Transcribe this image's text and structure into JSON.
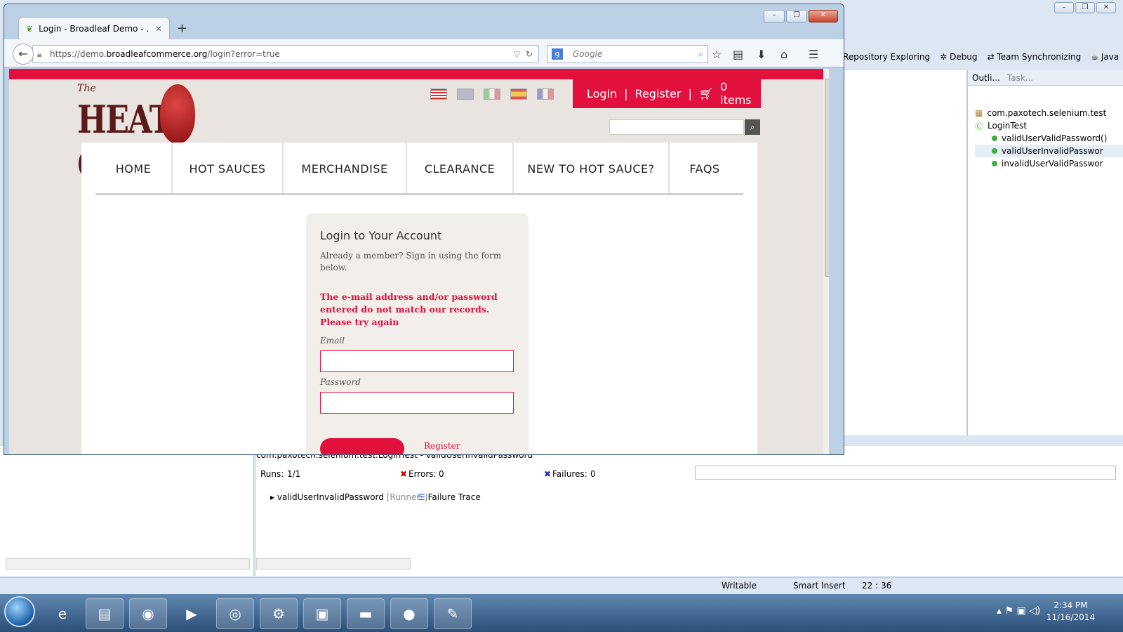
{
  "eclipse": {
    "perspectives": [
      "VN Repository Exploring",
      "Debug",
      "Team Synchronizing",
      "Java"
    ],
    "outline_tabs": [
      "Outli...",
      "Task..."
    ],
    "outline_tree": {
      "package": "com.paxotech.selenium.test",
      "class": "LoginTest",
      "methods": [
        "validUserValidPassword()",
        "validUserInvalidPasswor",
        "invalidUserValidPasswor"
      ]
    },
    "junit": {
      "title": "com.paxotech.selenium.test.LoginTest - validUserInvalidPassword",
      "runs_label": "Runs:",
      "runs_value": "1/1",
      "errors_label": "Errors:",
      "errors_value": "0",
      "failures_label": "Failures:",
      "failures_value": "0",
      "test_item": "validUserInvalidPassword",
      "runner_suffix": "[Runner: J",
      "failure_trace": "Failure Trace"
    },
    "status": {
      "writable": "Writable",
      "insert": "Smart Insert",
      "position": "22 : 36"
    }
  },
  "taskbar": {
    "time": "2:34 PM",
    "date": "11/16/2014"
  },
  "browser": {
    "tab_title": "Login - Broadleaf Demo - ...",
    "url_prefix": "https://demo.",
    "url_domain": "broadleafcommerce.org",
    "url_path": "/login?error=true",
    "search_placeholder": "Google"
  },
  "site": {
    "logo_small": "The",
    "logo_text": "HEAT CLINIC",
    "login": "Login",
    "separator": "|",
    "register": "Register",
    "cart": "0 items",
    "nav": [
      "HOME",
      "HOT SAUCES",
      "MERCHANDISE",
      "CLEARANCE",
      "NEW TO HOT SAUCE?",
      "FAQS"
    ],
    "login_title": "Login to Your Account",
    "login_sub": "Already a member? Sign in using the form below.",
    "error_msg": "The e-mail address and/or password entered do not match our records. Please try again",
    "email_label": "Email",
    "password_label": "Password",
    "register_link": "Register"
  },
  "colors": {
    "brand_red": "#e2103d",
    "logo_brown": "#5a1a1a"
  }
}
